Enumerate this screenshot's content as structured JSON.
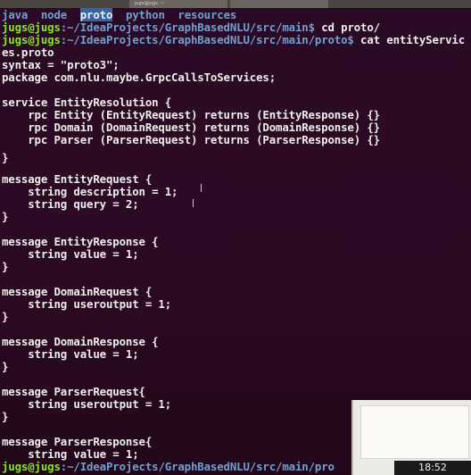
{
  "window": {
    "tab_title": "jugs@jugs: ~"
  },
  "terminal": {
    "ls_output": [
      "java",
      "node",
      "proto",
      "python",
      "resources"
    ],
    "prompt_user": "jugs@jugs",
    "lines": [
      {
        "path": ":~/IdeaProjects/GraphBasedNLU/src/main$",
        "cmd": " cd proto/"
      },
      {
        "path": ":~/IdeaProjects/GraphBasedNLU/src/main/proto$",
        "cmd": " cat entityServic"
      },
      "es.proto",
      "syntax = \"proto3\";",
      "package com.nlu.maybe.GrpcCallsToServices;",
      "",
      "service EntityResolution {",
      "    rpc Entity (EntityRequest) returns (EntityResponse) {}",
      "    rpc Domain (DomainRequest) returns (DomainResponse) {}",
      "    rpc Parser (ParserRequest) returns (ParserResponse) {}",
      "",
      "}",
      "",
      "message EntityRequest {",
      "    string description = 1;",
      "    string query = 2;",
      "}",
      "",
      "message EntityResponse {",
      "    string value = 1;",
      "}",
      "",
      "message DomainRequest {",
      "    string useroutput = 1;",
      "}",
      "",
      "message DomainResponse {",
      "    string value = 1;",
      "}",
      "",
      "message ParserRequest{",
      "    string useroutput = 1;",
      "}",
      "",
      "message ParserResponse{",
      "    string value = 1;",
      "}"
    ],
    "final_prompt_path": ":~/IdeaProjects/GraphBasedNLU/src/main/pro"
  },
  "taskbar": {
    "clock": "18:52"
  }
}
